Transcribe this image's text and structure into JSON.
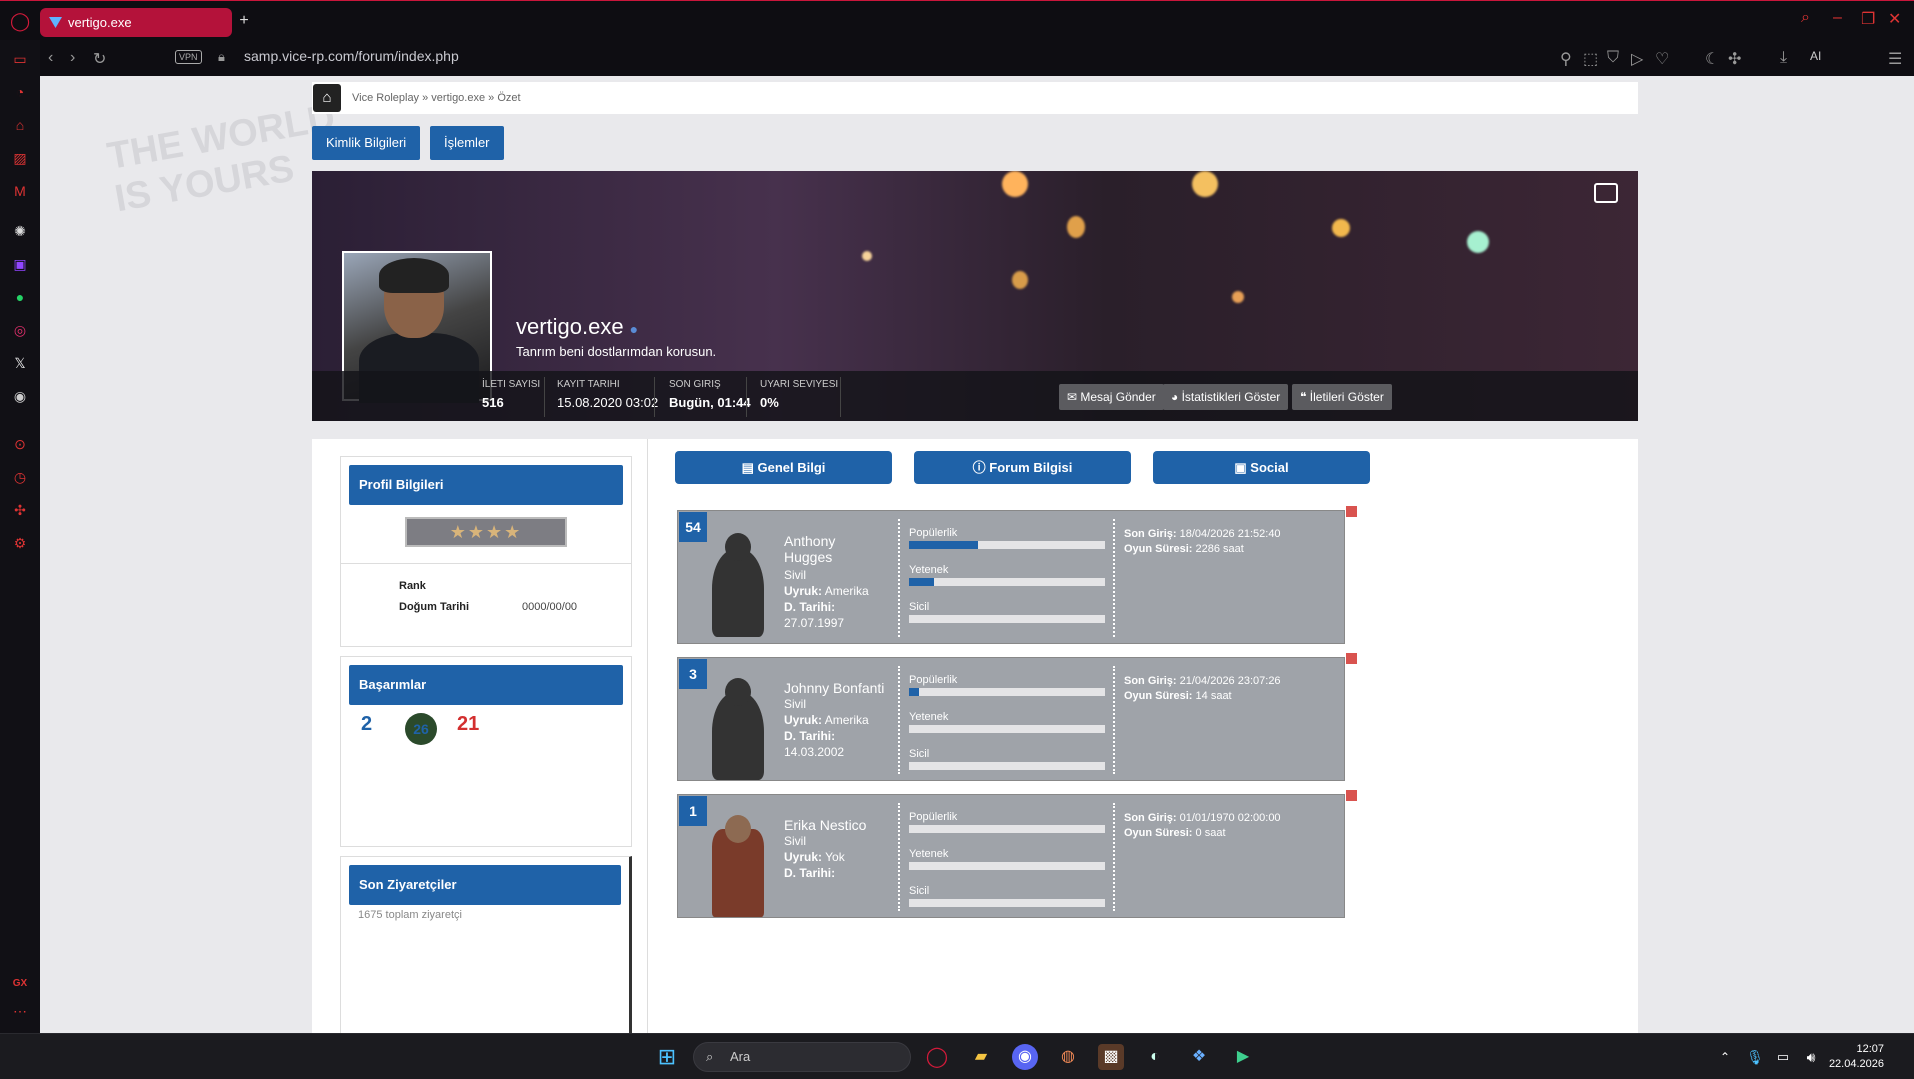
{
  "browser": {
    "tab_title": "vertigo.exe",
    "new_tab": "+",
    "url": "samp.vice-rp.com/forum/index.php",
    "vpn_label": "VPN",
    "ai_label": "AI",
    "side_gx": "GX"
  },
  "breadcrumb": {
    "text": "Vice Roleplay » vertigo.exe » Özet"
  },
  "tabs": {
    "kimlik": "Kimlik Bilgileri",
    "islemler": "İşlemler"
  },
  "profile": {
    "username": "vertigo.exe",
    "tagline": "Tanrım beni dostlarımdan korusun.",
    "stats": [
      {
        "label": "İleti Sayısı",
        "value": "516"
      },
      {
        "label": "Kayıt Tarihi",
        "value": "15.08.2020 03:02"
      },
      {
        "label": "Son Giriş",
        "value": "Bugün, 01:44"
      },
      {
        "label": "Uyarı Seviyesi",
        "value": "0%"
      }
    ],
    "actions": {
      "message": "Mesaj Gönder",
      "stats": "İstatistikleri Göster",
      "posts": "İletileri Göster"
    }
  },
  "left": {
    "profile_title": "Profil Bilgileri",
    "stars": "★★★★",
    "rank_label": "Rank",
    "dob_label": "Doğum Tarihi",
    "dob_value": "0000/00/00",
    "achievements_title": "Başarımlar",
    "achievements": [
      "2",
      "26",
      "21"
    ],
    "visitors_title": "Son Ziyaretçiler",
    "visitors_count": "1675 toplam ziyaretçi"
  },
  "center_tabs": {
    "general": "Genel Bilgi",
    "forum": "Forum Bilgisi",
    "social": "Social"
  },
  "characters": [
    {
      "number": "54",
      "name": "Anthony Hugges",
      "job": "Sivil",
      "nationality_label": "Uyruk:",
      "nationality": "Amerika",
      "dob_label": "D. Tarihi:",
      "dob": "27.07.1997",
      "popularity_label": "Popülerlik",
      "popularity": 0.35,
      "skill_label": "Yetenek",
      "skill": 0.13,
      "record_label": "Sicil",
      "record": 0,
      "last_login_label": "Son Giriş:",
      "last_login": "18/04/2026 21:52:40",
      "playtime_label": "Oyun Süresi:",
      "playtime": "2286 saat"
    },
    {
      "number": "3",
      "name": "Johnny Bonfanti",
      "job": "Sivil",
      "nationality_label": "Uyruk:",
      "nationality": "Amerika",
      "dob_label": "D. Tarihi:",
      "dob": "14.03.2002",
      "popularity_label": "Popülerlik",
      "popularity": 0.05,
      "skill_label": "Yetenek",
      "skill": 0,
      "record_label": "Sicil",
      "record": 0,
      "last_login_label": "Son Giriş:",
      "last_login": "21/04/2026 23:07:26",
      "playtime_label": "Oyun Süresi:",
      "playtime": "14 saat"
    },
    {
      "number": "1",
      "name": "Erika Nestico",
      "job": "Sivil",
      "nationality_label": "Uyruk:",
      "nationality": "Yok",
      "dob_label": "D. Tarihi:",
      "dob": "",
      "popularity_label": "Popülerlik",
      "popularity": 0,
      "skill_label": "Yetenek",
      "skill": 0,
      "record_label": "Sicil",
      "record": 0,
      "last_login_label": "Son Giriş:",
      "last_login": "01/01/1970 02:00:00",
      "playtime_label": "Oyun Süresi:",
      "playtime": "0 saat"
    }
  ],
  "taskbar": {
    "search_placeholder": "Ara",
    "time": "12:07",
    "date": "22.04.2026"
  },
  "colors": {
    "accent": "#1f62a8",
    "brand_red": "#b4123a"
  }
}
